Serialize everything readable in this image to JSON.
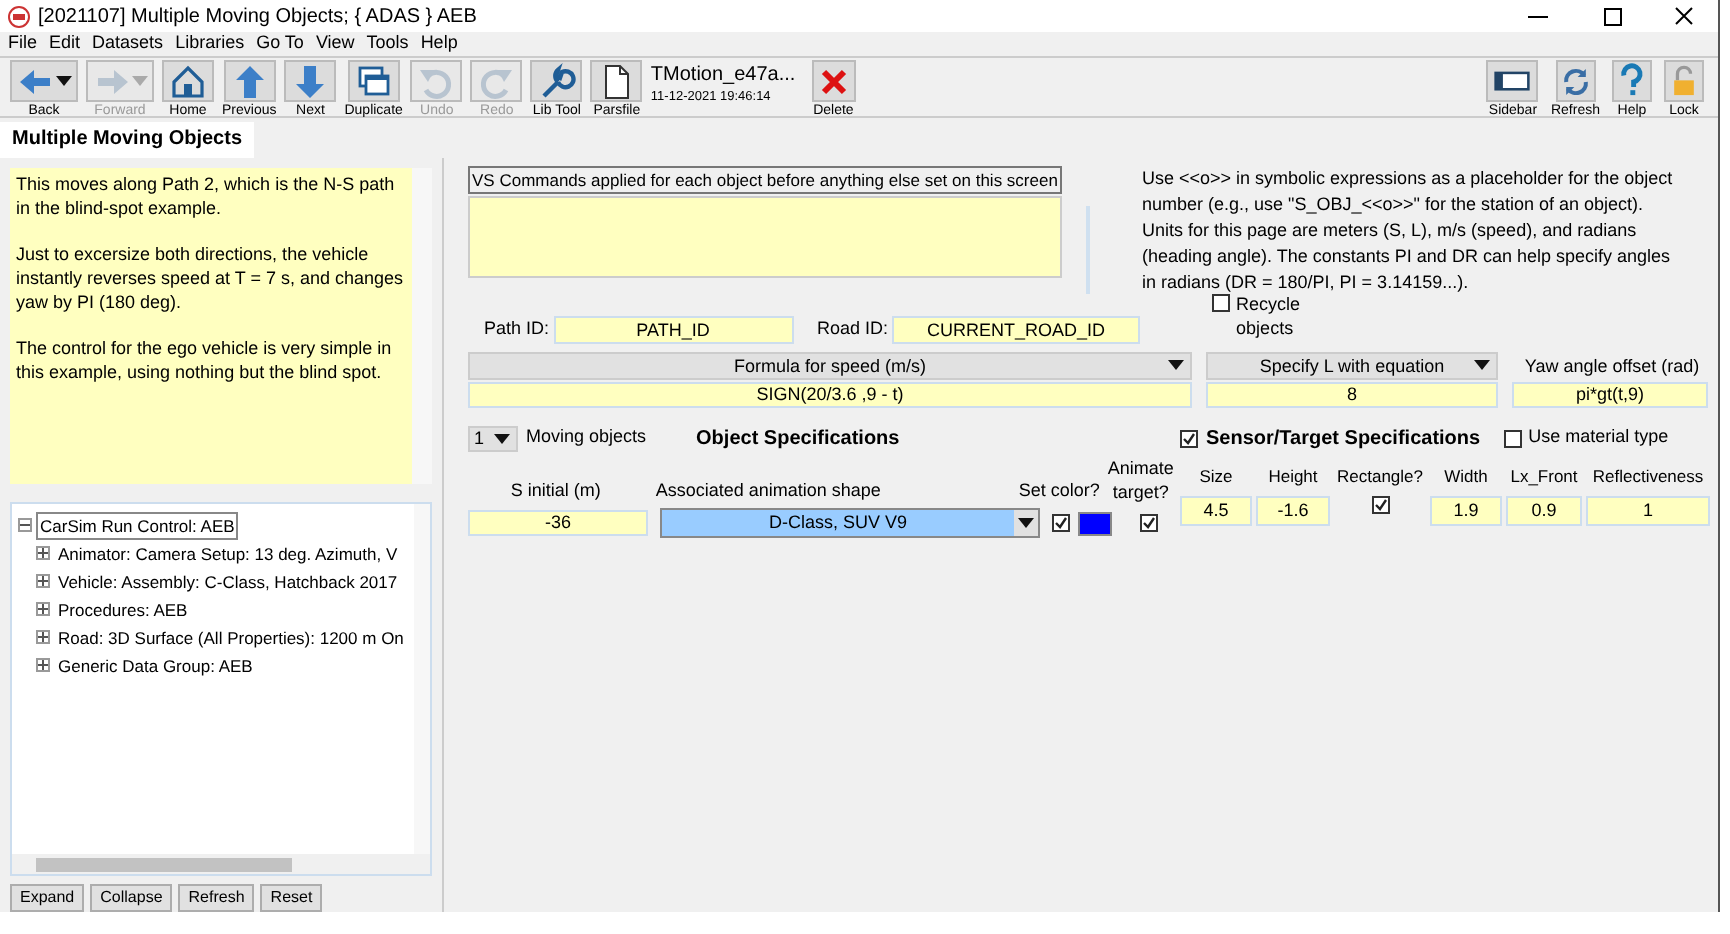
{
  "window": {
    "title": "[2021107] Multiple Moving Objects; { ADAS } AEB"
  },
  "menu": [
    "File",
    "Edit",
    "Datasets",
    "Libraries",
    "Go To",
    "View",
    "Tools",
    "Help"
  ],
  "toolbar": [
    {
      "kind": "back",
      "label": "Back",
      "disabled": false
    },
    {
      "kind": "forward",
      "label": "Forward",
      "disabled": true
    },
    {
      "kind": "home",
      "label": "Home",
      "disabled": false
    },
    {
      "kind": "previous",
      "label": "Previous",
      "disabled": false
    },
    {
      "kind": "next",
      "label": "Next",
      "disabled": false
    },
    {
      "kind": "duplicate",
      "label": "Duplicate",
      "disabled": false
    },
    {
      "kind": "undo",
      "label": "Undo",
      "disabled": true
    },
    {
      "kind": "redo",
      "label": "Redo",
      "disabled": true
    },
    {
      "kind": "libtool",
      "label": "Lib Tool",
      "disabled": false
    },
    {
      "kind": "parsfile",
      "label": "Parsfile",
      "disabled": false
    }
  ],
  "dataset": {
    "name": "TMotion_e47a...",
    "date": "11-12-2021 19:46:14"
  },
  "delete_button": {
    "label": "Delete"
  },
  "right_toolbar": [
    {
      "kind": "sidebar",
      "label": "Sidebar"
    },
    {
      "kind": "refresh",
      "label": "Refresh"
    },
    {
      "kind": "help",
      "label": "Help"
    },
    {
      "kind": "lock",
      "label": "Lock"
    }
  ],
  "tab": {
    "label": "Multiple Moving Objects"
  },
  "notes": [
    "This moves along Path 2, which is the N-S path in the blind-spot example.",
    "Just to excersize both directions, the vehicle instantly reverses speed at T = 7 s, and changes yaw by PI (180 deg).",
    "The control for the ego vehicle is very simple in this example, using nothing but the blind spot."
  ],
  "tree": [
    {
      "label": "CarSim Run Control: AEB",
      "expanded": true,
      "selected": true,
      "children": [
        {
          "label": "Animator: Camera Setup: 13 deg. Azimuth, V",
          "expanded": false,
          "selected": false
        },
        {
          "label": "Vehicle: Assembly: C-Class, Hatchback 2017",
          "expanded": false,
          "selected": false
        },
        {
          "label": "Procedures: AEB",
          "expanded": false,
          "selected": false
        },
        {
          "label": "Road: 3D Surface (All Properties): 1200 m On",
          "expanded": false,
          "selected": false
        },
        {
          "label": "Generic Data Group: AEB",
          "expanded": false,
          "selected": false
        }
      ]
    }
  ],
  "tree_buttons": [
    "Expand",
    "Collapse",
    "Refresh",
    "Reset"
  ],
  "vs_commands": {
    "label": "VS Commands applied for each object before anything else set on this screen"
  },
  "info": "Use <<o>> in symbolic expressions as a placeholder for the object number (e.g., use \"S_OBJ_<<o>>\" for the station of an object). Units for this page are meters (S, L), m/s (speed), and radians (heading angle). The constants PI and DR can help specify angles in radians (DR = 180/PI, PI = 3.14159...).",
  "path_id": {
    "label": "Path ID:",
    "value": "PATH_ID"
  },
  "road_id": {
    "label": "Road ID:",
    "value": "CURRENT_ROAD_ID"
  },
  "recycle_objects": {
    "label": "Recycle objects",
    "checked": false
  },
  "speed": {
    "mode": "Formula for speed (m/s)",
    "value": "SIGN(20/3.6 ,9 - t)"
  },
  "lateral": {
    "mode": "Specify L with equation",
    "value": "8"
  },
  "yaw": {
    "label": "Yaw angle offset (rad)",
    "value": "pi*gt(t,9)"
  },
  "moving_objects": {
    "count": "1",
    "label": "Moving objects"
  },
  "object_specs": {
    "title": "Object Specifications",
    "s_initial_label": "S initial (m)",
    "s_initial": "-36",
    "shape_label": "Associated animation shape",
    "shape": "D-Class, SUV V9",
    "set_color_label": "Set color?",
    "set_color": true,
    "color": "#0000ff",
    "animate_label": "Animate target?",
    "animate": true
  },
  "sensor_specs": {
    "title": "Sensor/Target Specifications",
    "checked": true,
    "use_material": {
      "label": "Use material type",
      "checked": false
    },
    "fields": [
      {
        "kind": "field",
        "label": "Size",
        "value": "4.5"
      },
      {
        "kind": "field",
        "label": "Height",
        "value": "-1.6"
      },
      {
        "kind": "check",
        "label": "Rectangle?",
        "checked": true
      },
      {
        "kind": "field",
        "label": "Width",
        "value": "1.9"
      },
      {
        "kind": "field",
        "label": "Lx_Front",
        "value": "0.9"
      },
      {
        "kind": "field",
        "label": "Reflectiveness",
        "value": "1"
      }
    ]
  }
}
